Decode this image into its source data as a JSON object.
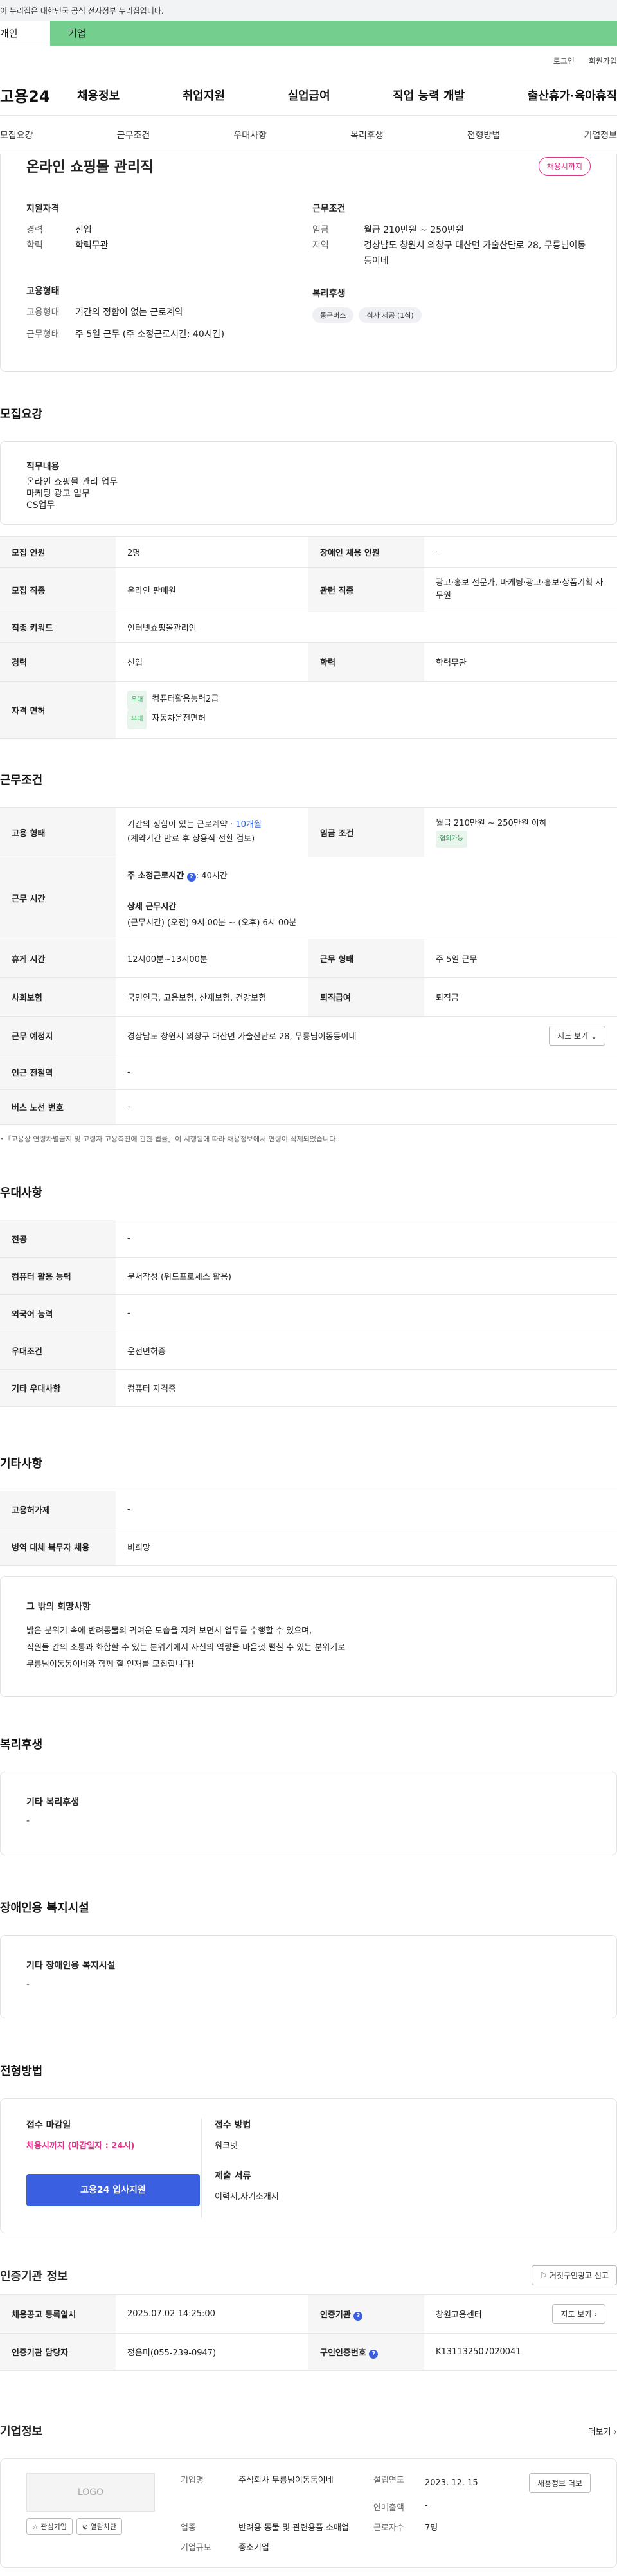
{
  "gov_banner": "이 누리집은 대한민국 공식 전자정부 누리집입니다.",
  "site_tabs": {
    "personal": "개인",
    "company": "기업"
  },
  "util": {
    "login": "로그인",
    "join": "회원가입"
  },
  "gnb": {
    "logo": "고용24",
    "menu": [
      "채용정보",
      "취업지원",
      "실업급여",
      "직업 능력 개발",
      "출산휴가·육아휴직"
    ]
  },
  "anchor_tabs": [
    "모집요강",
    "근무조건",
    "우대사항",
    "복리후생",
    "전형방법",
    "기업정보"
  ],
  "summary": {
    "title": "온라인 쇼핑몰 관리직",
    "badge": "채용시까지",
    "qual_h": "지원자격",
    "qual": [
      {
        "k": "경력",
        "v": "신입"
      },
      {
        "k": "학력",
        "v": "학력무관"
      }
    ],
    "cond_h": "근무조건",
    "cond": [
      {
        "k": "임금",
        "v": "월급 210만원 ~ 250만원"
      },
      {
        "k": "지역",
        "v": "경상남도 창원시 의창구 대산면 가술산단로 28, 무릉님이동동이네"
      }
    ],
    "emp_h": "고용형태",
    "emp": [
      {
        "k": "고용형태",
        "v": "기간의 정함이 없는 근로계약"
      },
      {
        "k": "근무형태",
        "v": "주 5일 근무 (주 소정근로시간: 40시간)"
      }
    ],
    "welfare_h": "복리후생",
    "welfare": [
      "통근버스",
      "식사 제공 (1식)"
    ]
  },
  "recruit": {
    "title": "모집요강",
    "duty_h": "직무내용",
    "duty": [
      "온라인 쇼핑몰 관리 업무",
      "마케팅 광고 업무",
      "CS업무"
    ],
    "rows": [
      {
        "k1": "모집 인원",
        "v1": "2명",
        "k2": "장애인 채용 인원",
        "v2": "-"
      },
      {
        "k1": "모집 직종",
        "v1": "온라인 판매원",
        "k2": "관련 직종",
        "v2": "광고·홍보 전문가, 마케팅·광고·홍보·상품기획 사무원"
      }
    ],
    "keyword": {
      "k": "직종 키워드",
      "v": "인터넷쇼핑몰관리인"
    },
    "career": {
      "k1": "경력",
      "v1": "신입",
      "k2": "학력",
      "v2": "학력무관"
    },
    "license": {
      "k": "자격 면허",
      "tag": "우대",
      "items": [
        "컴퓨터활용능력2급",
        "자동차운전면허"
      ]
    }
  },
  "work": {
    "title": "근무조건",
    "type_k": "고용 형태",
    "type_v1": "기간의 정함이 있는 근로계약 · ",
    "type_v1b": "10개월",
    "type_v2": "(계약기간 만료 후 상용직 전환 검토)",
    "wage_k": "임금 조건",
    "wage_v": "월급 210만원 ~ 250만원 이하",
    "wage_tag": "협의가능",
    "hours_k": "근무 시간",
    "hours_h1": "주 소정근로시간",
    "hours_v1": ": 40시간",
    "hours_h2": "상세 근무시간",
    "hours_v2": "(근무시간) (오전) 9시 00분 ~ (오후) 6시 00분",
    "rest_k": "휴게 시간",
    "rest_v": "12시00분~13시00분",
    "form_k": "근무 형태",
    "form_v": "주 5일 근무",
    "ins_k": "사회보험",
    "ins_v": "국민연금, 고용보험, 산재보험, 건강보험",
    "ret_k": "퇴직급여",
    "ret_v": "퇴직금",
    "loc_k": "근무 예정지",
    "loc_v": "경상남도 창원시 의창구 대산면 가술산단로 28, 무릉님이동동이네",
    "map_btn": "지도 보기",
    "subway_k": "인근 전철역",
    "subway_v": "-",
    "bus_k": "버스 노선 번호",
    "bus_v": "-",
    "note": "•「고용상 연령차별금지 및 고령자 고용촉진에 관한 법률」이 시행됨에 따라 채용정보에서 연령이 삭제되었습니다."
  },
  "pref": {
    "title": "우대사항",
    "rows": [
      {
        "k": "전공",
        "v": "-"
      },
      {
        "k": "컴퓨터 활용 능력",
        "v": "문서작성 (워드프로세스 활용)"
      },
      {
        "k": "외국어 능력",
        "v": "-"
      },
      {
        "k": "우대조건",
        "v": "운전면허증"
      },
      {
        "k": "기타 우대사항",
        "v": "컴퓨터 자격증"
      }
    ]
  },
  "etc": {
    "title": "기타사항",
    "rows": [
      {
        "k": "고용허가제",
        "v": "-"
      },
      {
        "k": "병역 대체 복무자 채용",
        "v": "비희망"
      }
    ],
    "talent_h": "그 밖의 희망사항",
    "talent": [
      "밝은 분위기 속에 반려동물의 귀여운 모습을 지켜 보면서 업무를 수행할 수 있으며,",
      "직원들 간의 소통과 화합할 수 있는 분위기에서 자신의 역량을 마음껏 펼칠 수 있는 분위기로",
      "무릉님이동동이네와 함께 할 인재를 모집합니다!"
    ]
  },
  "benefit": {
    "title": "복리후생",
    "h": "기타 복리후생",
    "v": "-"
  },
  "disabled": {
    "title": "장애인용 복지시설",
    "h": "기타 장애인용 복지시설",
    "v": "-"
  },
  "process": {
    "title": "전형방법",
    "deadline_h": "접수 마감일",
    "deadline_v": "채용시까지 (마감일자 : 24시)",
    "method_h": "접수 방법",
    "method_v": "워크넷",
    "docs_h": "제출 서류",
    "docs_v": "이력서,자기소개서",
    "apply_btn": "고용24 입사지원"
  },
  "agency": {
    "title": "인증기관 정보",
    "report_btn": "거짓구인광고 신고",
    "r1": {
      "k1": "채용공고 등록일시",
      "v1": "2025.07.02 14:25:00",
      "k2": "인증기관",
      "v2": "창원고용센터",
      "btn": "지도 보기"
    },
    "r2": {
      "k1": "인증기관 담당자",
      "v1": "정은미(055-239-0947)",
      "k2": "구인인증번호",
      "v2": "K131132507020041"
    }
  },
  "company": {
    "title": "기업정보",
    "more": "더보기",
    "logo": "LOGO",
    "fav_btn": "관심기업",
    "block_btn": "열람차단",
    "name_k": "기업명",
    "name_v": "주식회사 무릉님이동동이네",
    "year_k": "설립연도",
    "year_v": "2023. 12. 15",
    "info_btn": "채용정보 더보",
    "sales_k": "연매출액",
    "sales_v": "-",
    "biz_k": "업종",
    "biz_v": "반려용 동물 및 관련용품 소매업",
    "staff_k": "근로자수",
    "staff_v": "7명",
    "size_k": "기업규모",
    "size_v": "중소기업"
  }
}
